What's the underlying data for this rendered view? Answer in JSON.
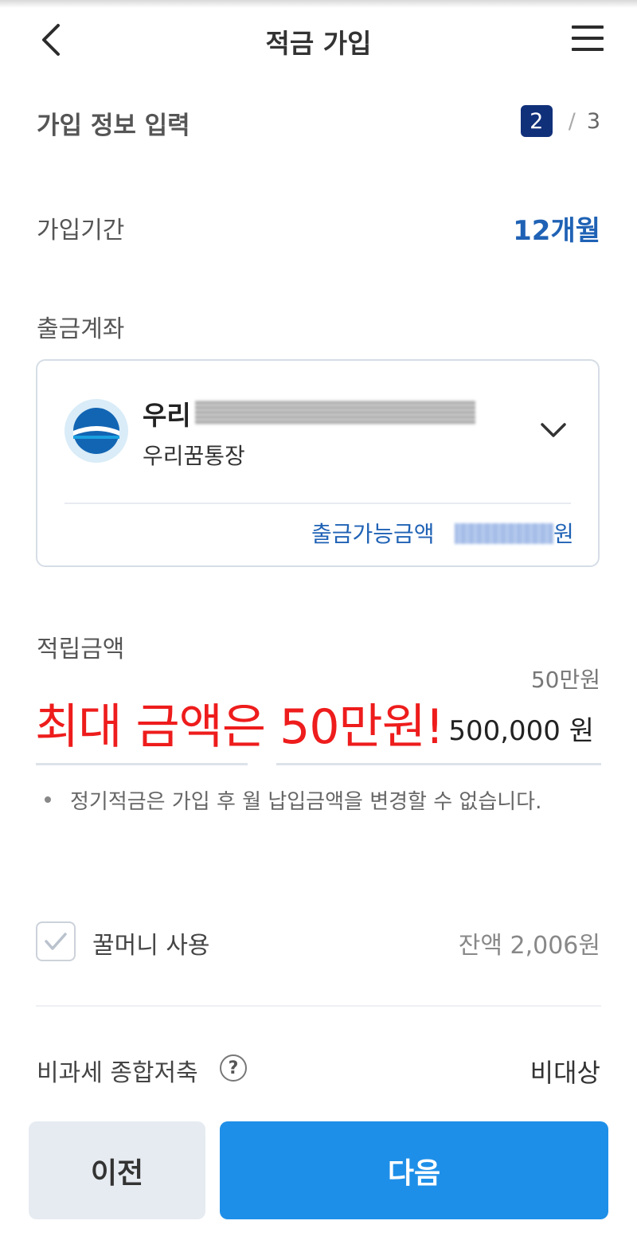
{
  "header": {
    "title": "적금 가입",
    "back_icon": "chevron-left-icon",
    "menu_icon": "hamburger-menu-icon"
  },
  "step": {
    "title": "가입 정보 입력",
    "current": "2",
    "separator": "/",
    "total": "3"
  },
  "period": {
    "label": "가입기간",
    "value": "12개월"
  },
  "account": {
    "label": "출금계좌",
    "name_prefix": "우리",
    "type": "우리꿈통장",
    "available_label": "출금가능금액",
    "available_unit": "원",
    "logo_icon": "woori-bank-logo",
    "dropdown_icon": "chevron-down-icon"
  },
  "deposit": {
    "label": "적립금액",
    "max_hint": "50만원",
    "annotation": "최대 금액은 50만원!",
    "amount": "500,000 원",
    "note": "정기적금은 가입 후 월 납입금액을 변경할 수 없습니다."
  },
  "honey_money": {
    "label": "꿀머니 사용",
    "balance": "잔액 2,006원",
    "checked": true
  },
  "tax": {
    "label": "비과세 종합저축",
    "help": "?",
    "value": "비대상"
  },
  "buttons": {
    "prev": "이전",
    "next": "다음"
  },
  "colors": {
    "accent_blue": "#1f62b5",
    "primary_button": "#1e8fe8",
    "step_badge": "#11307a",
    "annotation_red": "#ee1c1c"
  }
}
